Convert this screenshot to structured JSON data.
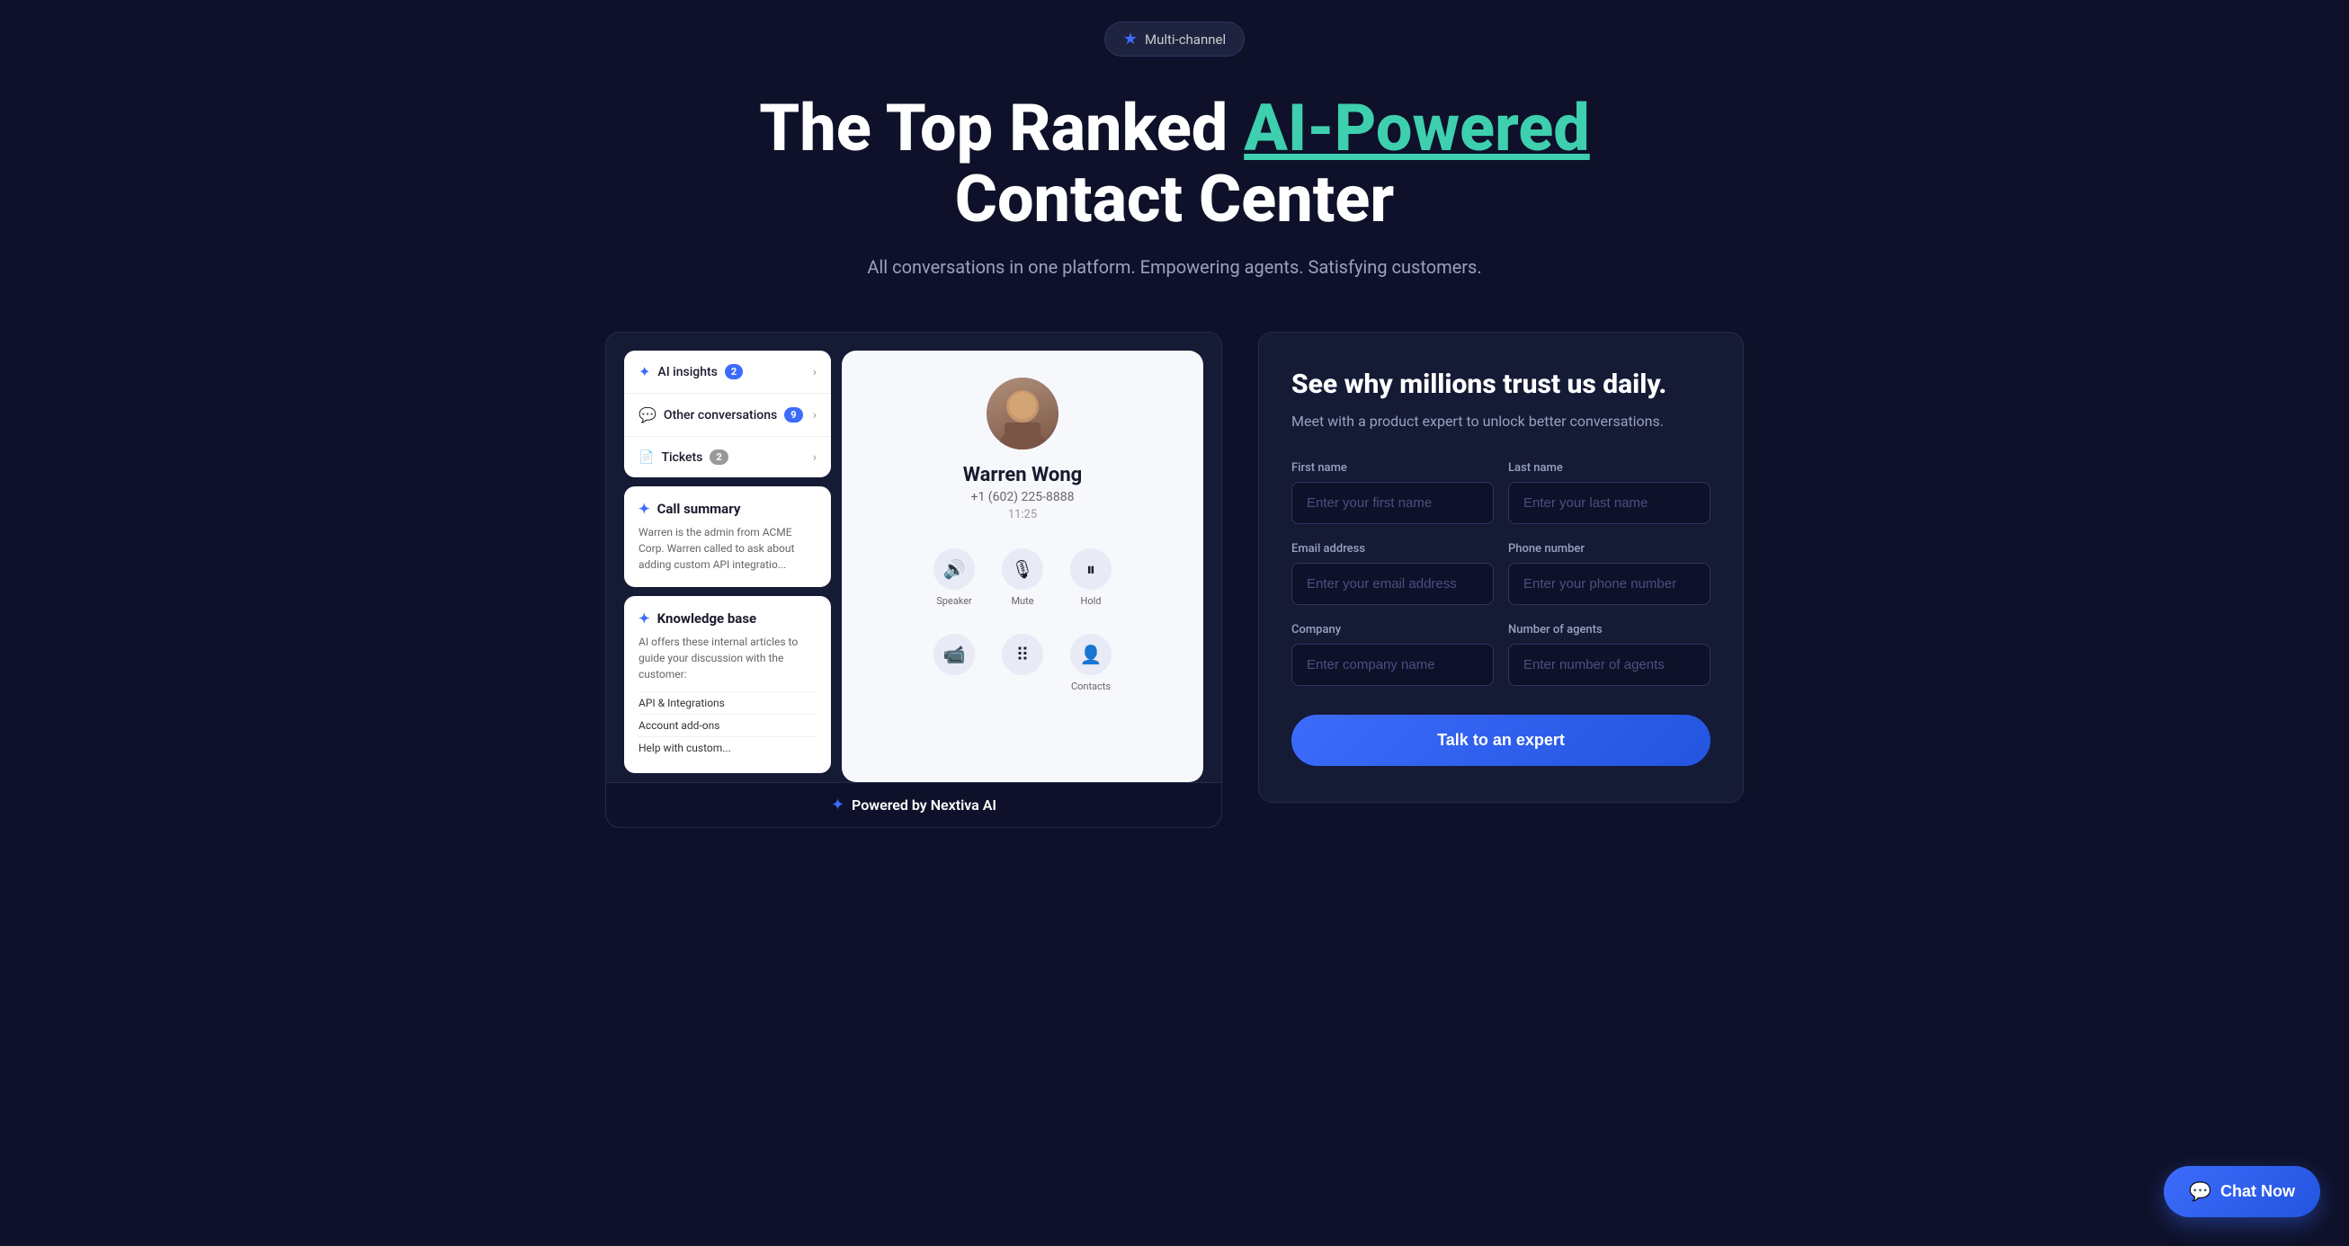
{
  "badge": {
    "icon": "★",
    "label": "Multi-channel"
  },
  "hero": {
    "title_start": "The Top Ranked ",
    "title_highlight": "AI-Powered",
    "title_end": "Contact Center",
    "subtitle": "All conversations in one platform. Empowering agents. Satisfying customers."
  },
  "ui_preview": {
    "insights_row": {
      "icon": "✦",
      "label": "AI insights",
      "badge": "2"
    },
    "conversations_row": {
      "icon": "💬",
      "label": "Other conversations",
      "badge": "9"
    },
    "tickets_row": {
      "icon": "📄",
      "label": "Tickets",
      "badge": "2"
    },
    "call_summary": {
      "title": "Call summary",
      "text": "Warren is the admin from ACME Corp. Warren called to ask about adding custom API integratio..."
    },
    "knowledge_base": {
      "title": "Knowledge base",
      "text": "AI offers these internal articles to guide your discussion with the customer:",
      "items": [
        "API & Integrations",
        "Account add-ons",
        "Help with custom..."
      ]
    },
    "caller": {
      "name": "Warren Wong",
      "phone": "+1 (602) 225-8888",
      "time": "11:25"
    },
    "controls": [
      {
        "icon": "🔊",
        "label": "Speaker"
      },
      {
        "icon": "🎙",
        "label": "Mute"
      },
      {
        "icon": "⏸",
        "label": "Hold"
      }
    ],
    "controls_bottom": [
      {
        "icon": "📹",
        "label": ""
      },
      {
        "icon": "⠿",
        "label": ""
      },
      {
        "icon": "👤+",
        "label": "Contacts"
      }
    ],
    "powered_by": "Powered by Nextiva AI"
  },
  "form": {
    "heading": "See why millions trust us daily.",
    "subheading": "Meet with a product expert to unlock better conversations.",
    "fields": {
      "first_name": {
        "label": "First name",
        "placeholder": "Enter your first name"
      },
      "last_name": {
        "label": "Last name",
        "placeholder": "Enter your last name"
      },
      "email": {
        "label": "Email address",
        "placeholder": "Enter your email address"
      },
      "phone": {
        "label": "Phone number",
        "placeholder": "Enter your phone number"
      },
      "company": {
        "label": "Company",
        "placeholder": "Enter company name"
      },
      "agents": {
        "label": "Number of agents",
        "placeholder": "Enter number of agents"
      }
    },
    "submit_label": "Talk to an expert"
  },
  "chat_button": {
    "label": "Chat Now",
    "icon": "💬"
  }
}
